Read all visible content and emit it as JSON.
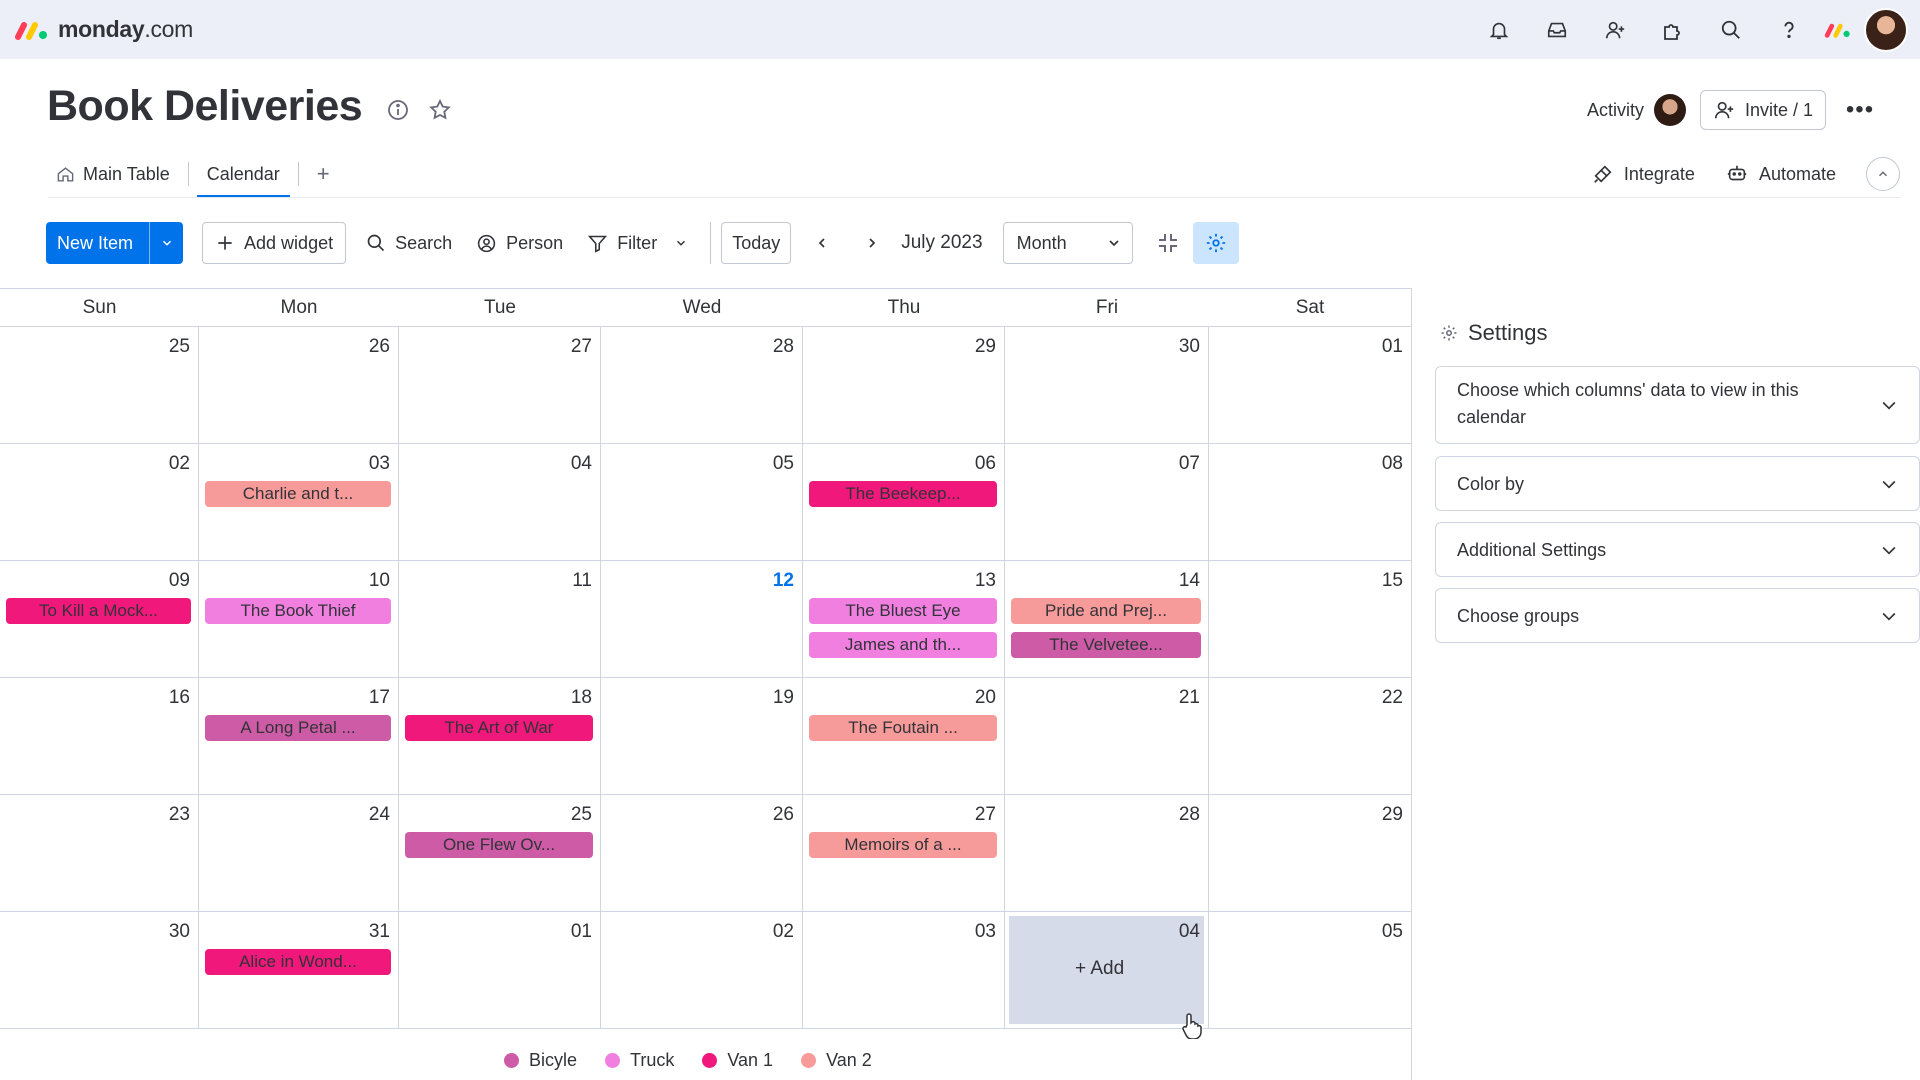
{
  "app": {
    "brand": "monday",
    "brand_suffix": ".com"
  },
  "board": {
    "title": "Book Deliveries"
  },
  "header": {
    "activity_label": "Activity",
    "invite_label": "Invite / 1"
  },
  "tabs": [
    {
      "label": "Main Table"
    },
    {
      "label": "Calendar"
    }
  ],
  "add_tab": "+",
  "tabs_right": {
    "integrate_label": "Integrate",
    "automate_label": "Automate"
  },
  "toolbar": {
    "new_item_label": "New Item",
    "add_widget_label": "Add widget",
    "search_label": "Search",
    "person_label": "Person",
    "filter_label": "Filter",
    "today_label": "Today",
    "current_month": "July 2023",
    "view_mode": "Month"
  },
  "calendar": {
    "day_names": [
      "Sun",
      "Mon",
      "Tue",
      "Wed",
      "Thu",
      "Fri",
      "Sat"
    ],
    "weeks": [
      [
        "25",
        "26",
        "27",
        "28",
        "29",
        "30",
        "01"
      ],
      [
        "02",
        "03",
        "04",
        "05",
        "06",
        "07",
        "08"
      ],
      [
        "09",
        "10",
        "11",
        "12",
        "13",
        "14",
        "15"
      ],
      [
        "16",
        "17",
        "18",
        "19",
        "20",
        "21",
        "22"
      ],
      [
        "23",
        "24",
        "25",
        "26",
        "27",
        "28",
        "29"
      ],
      [
        "30",
        "31",
        "01",
        "02",
        "03",
        "04",
        "05"
      ]
    ],
    "today": "12",
    "add_label": "+ Add",
    "events": [
      {
        "label": "Charlie and t...",
        "week": 1,
        "day": 1,
        "slot": 0,
        "group": "Van 2"
      },
      {
        "label": "The Beekeep...",
        "week": 1,
        "day": 4,
        "slot": 0,
        "group": "Van 1"
      },
      {
        "label": "To Kill a Mock...",
        "week": 2,
        "day": 0,
        "slot": 0,
        "group": "Van 1"
      },
      {
        "label": "The Book Thief",
        "week": 2,
        "day": 1,
        "slot": 0,
        "group": "Truck"
      },
      {
        "label": "The Bluest Eye",
        "week": 2,
        "day": 4,
        "slot": 0,
        "group": "Truck"
      },
      {
        "label": "James and th...",
        "week": 2,
        "day": 4,
        "slot": 1,
        "group": "Truck"
      },
      {
        "label": "Pride and Prej...",
        "week": 2,
        "day": 5,
        "slot": 0,
        "group": "Van 2"
      },
      {
        "label": "The Velvetee...",
        "week": 2,
        "day": 5,
        "slot": 1,
        "group": "Bicyle"
      },
      {
        "label": "A Long Petal ...",
        "week": 3,
        "day": 1,
        "slot": 0,
        "group": "Bicyle"
      },
      {
        "label": "The Art of War",
        "week": 3,
        "day": 2,
        "slot": 0,
        "group": "Van 1"
      },
      {
        "label": "The Foutain ...",
        "week": 3,
        "day": 4,
        "slot": 0,
        "group": "Van 2"
      },
      {
        "label": "One Flew Ov...",
        "week": 4,
        "day": 2,
        "slot": 0,
        "group": "Bicyle"
      },
      {
        "label": "Memoirs of a ...",
        "week": 4,
        "day": 4,
        "slot": 0,
        "group": "Van 2"
      },
      {
        "label": "Alice in Wond...",
        "week": 5,
        "day": 1,
        "slot": 0,
        "group": "Van 1"
      }
    ]
  },
  "legend": [
    {
      "label": "Bicyle",
      "color": "#cd5ba5"
    },
    {
      "label": "Truck",
      "color": "#f07fe0"
    },
    {
      "label": "Van 1",
      "color": "#f0187a"
    },
    {
      "label": "Van 2",
      "color": "#f79a9a"
    }
  ],
  "settings": {
    "title": "Settings",
    "sections": [
      {
        "label": "Choose which columns' data to view in this calendar"
      },
      {
        "label": "Color by"
      },
      {
        "label": "Additional Settings"
      },
      {
        "label": "Choose groups"
      }
    ]
  },
  "colors": {
    "accent": "#0073ea",
    "topbar": "#eceff8",
    "add_cell": "#d6dbea"
  }
}
